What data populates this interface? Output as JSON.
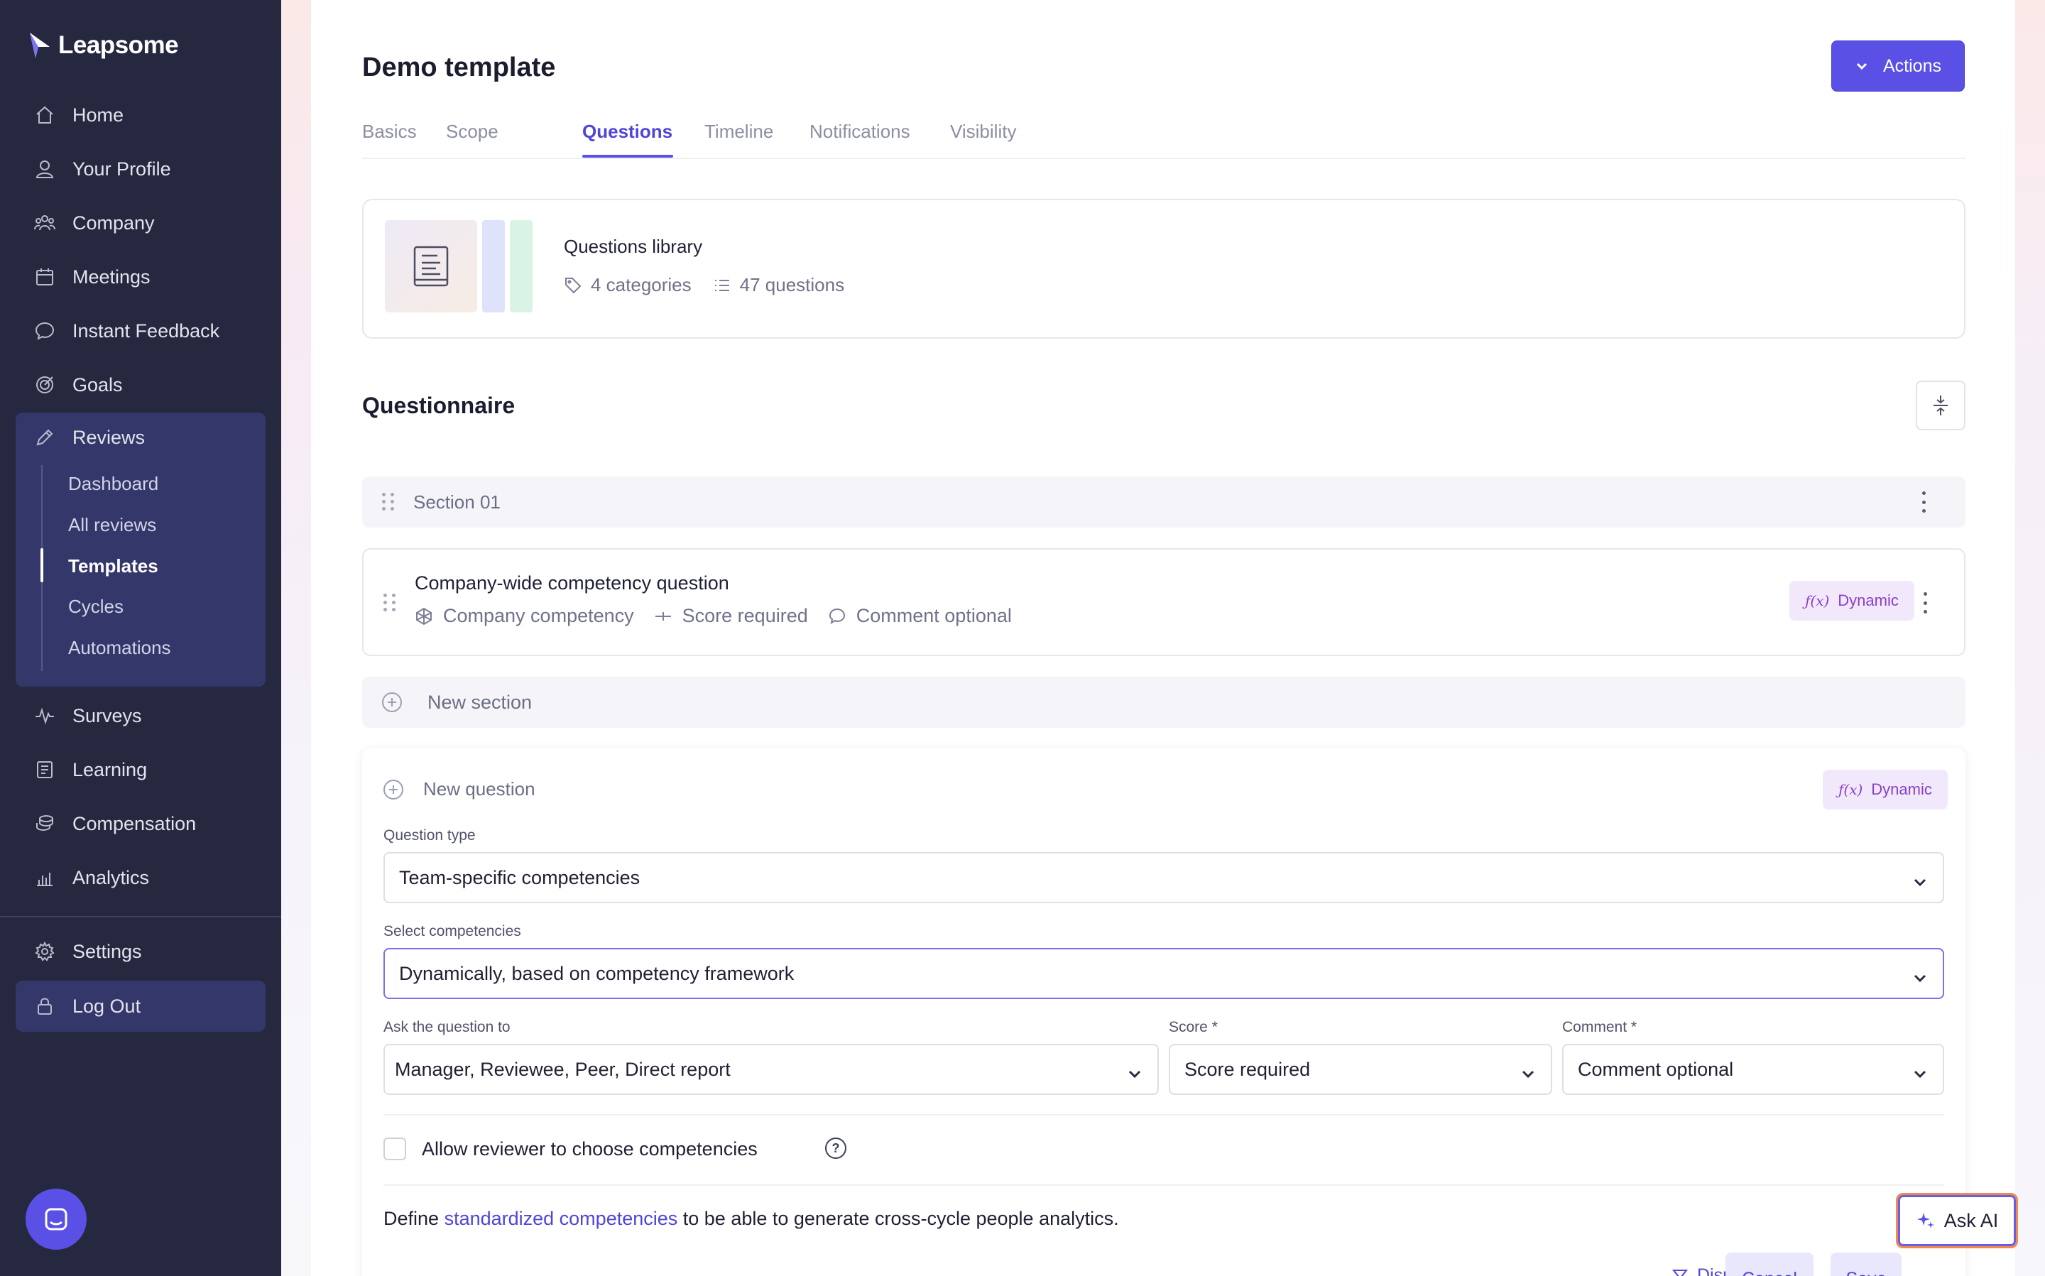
{
  "app": {
    "brand": "Leapsome"
  },
  "sidebar": {
    "items": [
      {
        "label": "Home",
        "icon": "home-icon"
      },
      {
        "label": "Your Profile",
        "icon": "user-icon"
      },
      {
        "label": "Company",
        "icon": "people-icon"
      },
      {
        "label": "Meetings",
        "icon": "calendar-icon"
      },
      {
        "label": "Instant Feedback",
        "icon": "chat-bubble-icon"
      },
      {
        "label": "Goals",
        "icon": "target-icon"
      },
      {
        "label": "Reviews",
        "icon": "pencil-icon"
      },
      {
        "label": "Surveys",
        "icon": "pulse-icon"
      },
      {
        "label": "Learning",
        "icon": "book-icon"
      },
      {
        "label": "Compensation",
        "icon": "coins-icon"
      },
      {
        "label": "Analytics",
        "icon": "chart-icon"
      },
      {
        "label": "Settings",
        "icon": "gear-icon"
      },
      {
        "label": "Log Out",
        "icon": "lock-icon"
      }
    ],
    "reviews_sub": [
      "Dashboard",
      "All reviews",
      "Templates",
      "Cycles",
      "Automations"
    ],
    "active_sub": "Templates"
  },
  "header": {
    "title": "Demo template",
    "actions_label": "Actions"
  },
  "tabs": [
    "Basics",
    "Scope",
    "Questions",
    "Timeline",
    "Notifications",
    "Visibility"
  ],
  "active_tab": "Questions",
  "library": {
    "title": "Questions library",
    "categories": "4 categories",
    "questions": "47 questions"
  },
  "questionnaire": {
    "heading": "Questionnaire",
    "section_label": "Section 01",
    "question": {
      "title": "Company-wide competency question",
      "type": "Company competency",
      "score": "Score required",
      "comment": "Comment optional",
      "badge": "Dynamic",
      "fx": "ƒ(x)"
    },
    "new_section_label": "New section"
  },
  "new_question": {
    "label": "New question",
    "badge": "Dynamic",
    "fx": "ƒ(x)",
    "question_type_label": "Question type",
    "question_type_value": "Team-specific competencies",
    "select_comp_label": "Select competencies",
    "select_comp_value": "Dynamically, based on competency framework",
    "ask_label": "Ask the question to",
    "ask_value": "Manager, Reviewee, Peer, Direct report",
    "score_label": "Score *",
    "score_value": "Score required",
    "comment_label": "Comment *",
    "comment_value": "Comment optional",
    "allow_choose_label": "Allow reviewer to choose competencies",
    "help_glyph": "?",
    "define_prefix": "Define ",
    "define_link": "standardized competencies",
    "define_suffix": " to be able to generate cross-cycle people analytics.",
    "display_rules": "Display rules",
    "cancel": "Cancel",
    "save": "Save"
  },
  "ask_ai": {
    "label": "Ask AI"
  },
  "colors": {
    "sidebar_bg": "#262840",
    "accent": "#5b50e6",
    "dynamic_badge_bg": "#f2e8fb",
    "dynamic_badge_text": "#8a3fc9"
  }
}
